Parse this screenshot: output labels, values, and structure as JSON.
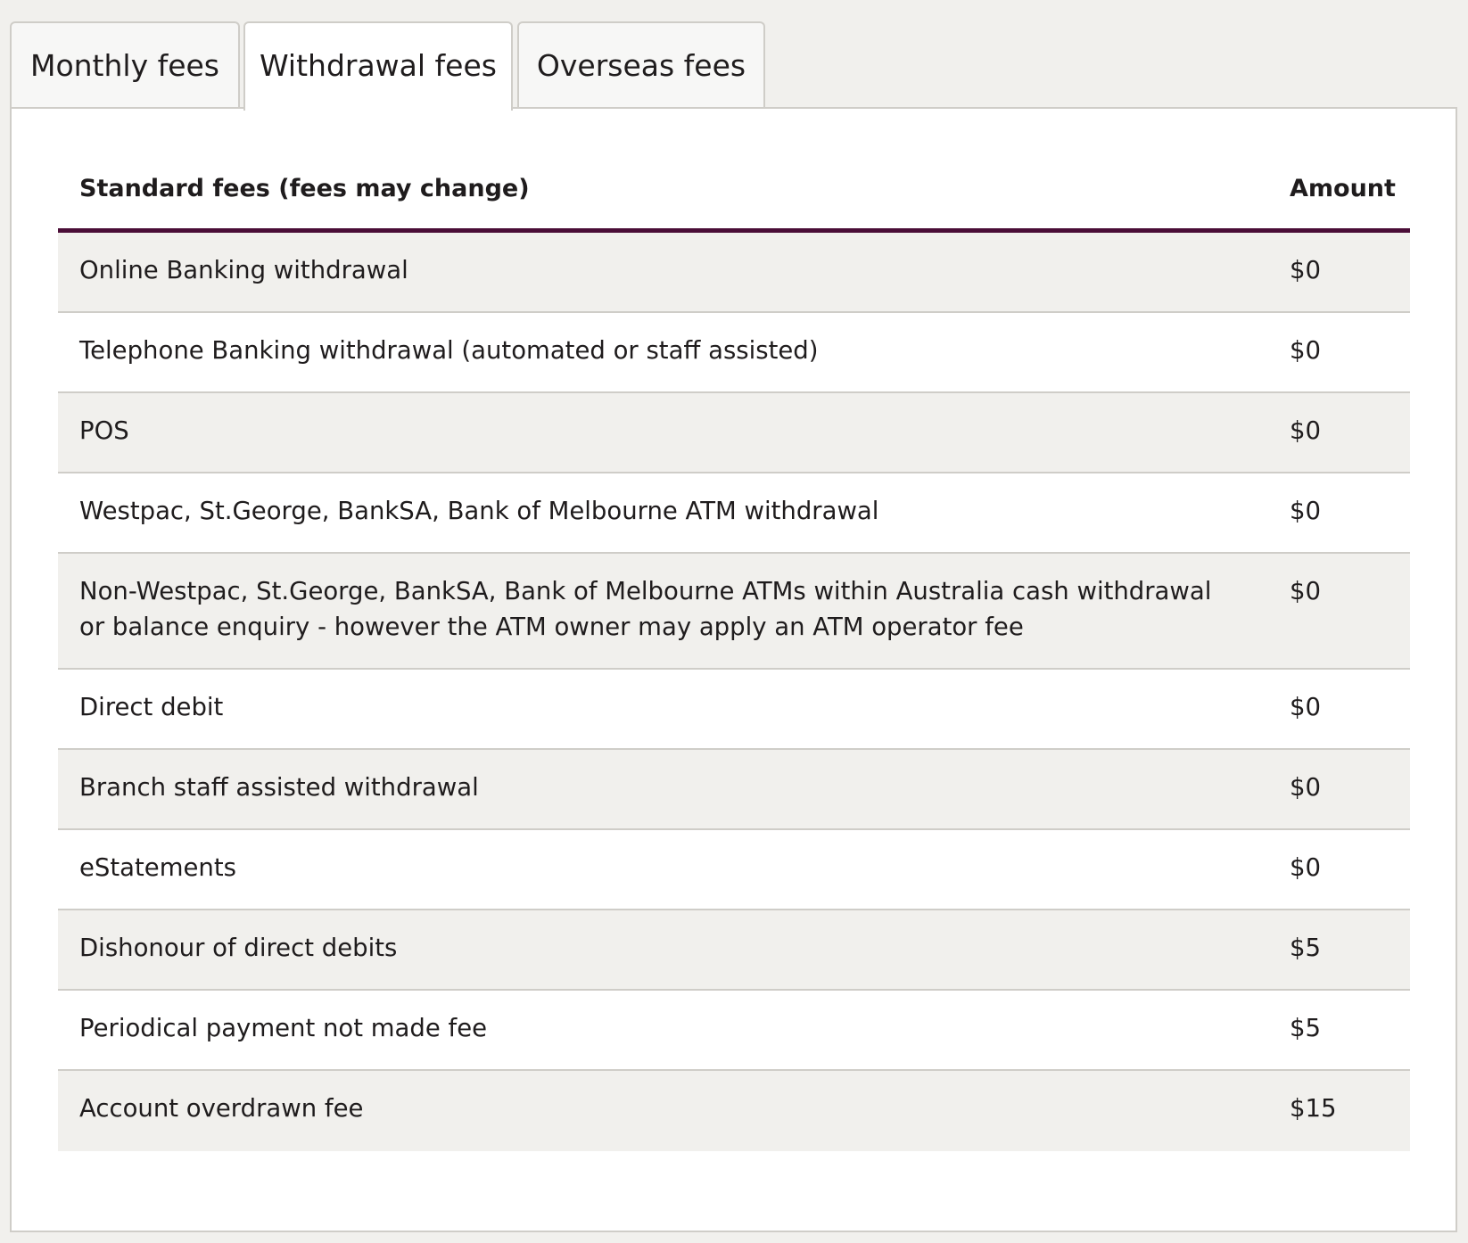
{
  "tabs": [
    {
      "label": "Monthly fees",
      "active": false
    },
    {
      "label": "Withdrawal fees",
      "active": true
    },
    {
      "label": "Overseas fees",
      "active": false
    }
  ],
  "table": {
    "header_description": "Standard fees (fees may change)",
    "header_amount": "Amount",
    "rows": [
      {
        "description": "Online Banking withdrawal",
        "amount": "$0"
      },
      {
        "description": "Telephone Banking withdrawal (automated or staff assisted)",
        "amount": "$0"
      },
      {
        "description": "POS",
        "amount": "$0"
      },
      {
        "description": "Westpac, St.George, BankSA, Bank of Melbourne ATM withdrawal",
        "amount": "$0"
      },
      {
        "description": "Non-Westpac, St.George, BankSA, Bank of Melbourne ATMs within Australia cash withdrawal or balance enquiry - however the ATM owner may apply an ATM operator fee",
        "amount": "$0"
      },
      {
        "description": "Direct debit",
        "amount": "$0"
      },
      {
        "description": "Branch staff assisted withdrawal",
        "amount": "$0"
      },
      {
        "description": "eStatements",
        "amount": "$0"
      },
      {
        "description": "Dishonour of direct debits",
        "amount": "$5"
      },
      {
        "description": "Periodical payment not made fee",
        "amount": "$5"
      },
      {
        "description": "Account overdrawn fee",
        "amount": "$15"
      }
    ]
  },
  "colors": {
    "accent": "#4a0d37",
    "row_shade": "#f1f0ed",
    "border": "#cfcdc8"
  }
}
